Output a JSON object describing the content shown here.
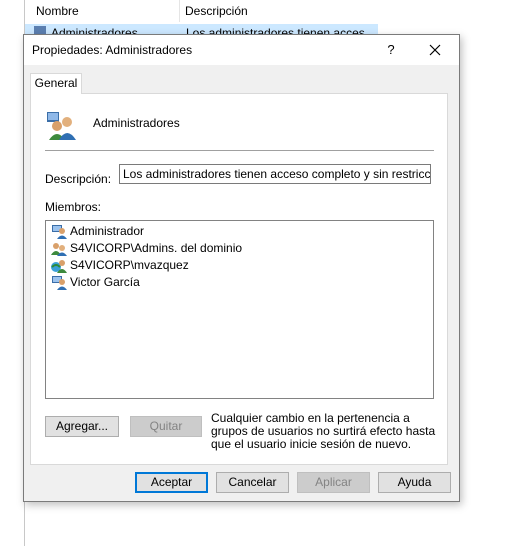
{
  "background": {
    "col_name": "Nombre",
    "col_desc": "Descripción",
    "row_name": "Administradores",
    "row_desc": "Los administradores tienen acces"
  },
  "dialog": {
    "title": "Propiedades: Administradores",
    "help_label": "?",
    "close_label": "✕",
    "tab_general": "General",
    "group_name": "Administradores",
    "desc_label": "Descripción:",
    "desc_value": "Los administradores tienen acceso completo y sin restricciones al",
    "members_label": "Miembros:",
    "members": [
      {
        "name": "Administrador",
        "icon": "user-icon"
      },
      {
        "name": "S4VICORP\\Admins. del dominio",
        "icon": "group-icon"
      },
      {
        "name": "S4VICORP\\mvazquez",
        "icon": "domain-user-icon"
      },
      {
        "name": "Victor García",
        "icon": "user-icon"
      }
    ],
    "add_label": "Agregar...",
    "remove_label": "Quitar",
    "note": "Cualquier cambio en la pertenencia a grupos de usuarios no surtirá efecto hasta que el usuario inicie sesión de nuevo.",
    "ok_label": "Aceptar",
    "cancel_label": "Cancelar",
    "apply_label": "Aplicar",
    "helpbtn_label": "Ayuda"
  }
}
